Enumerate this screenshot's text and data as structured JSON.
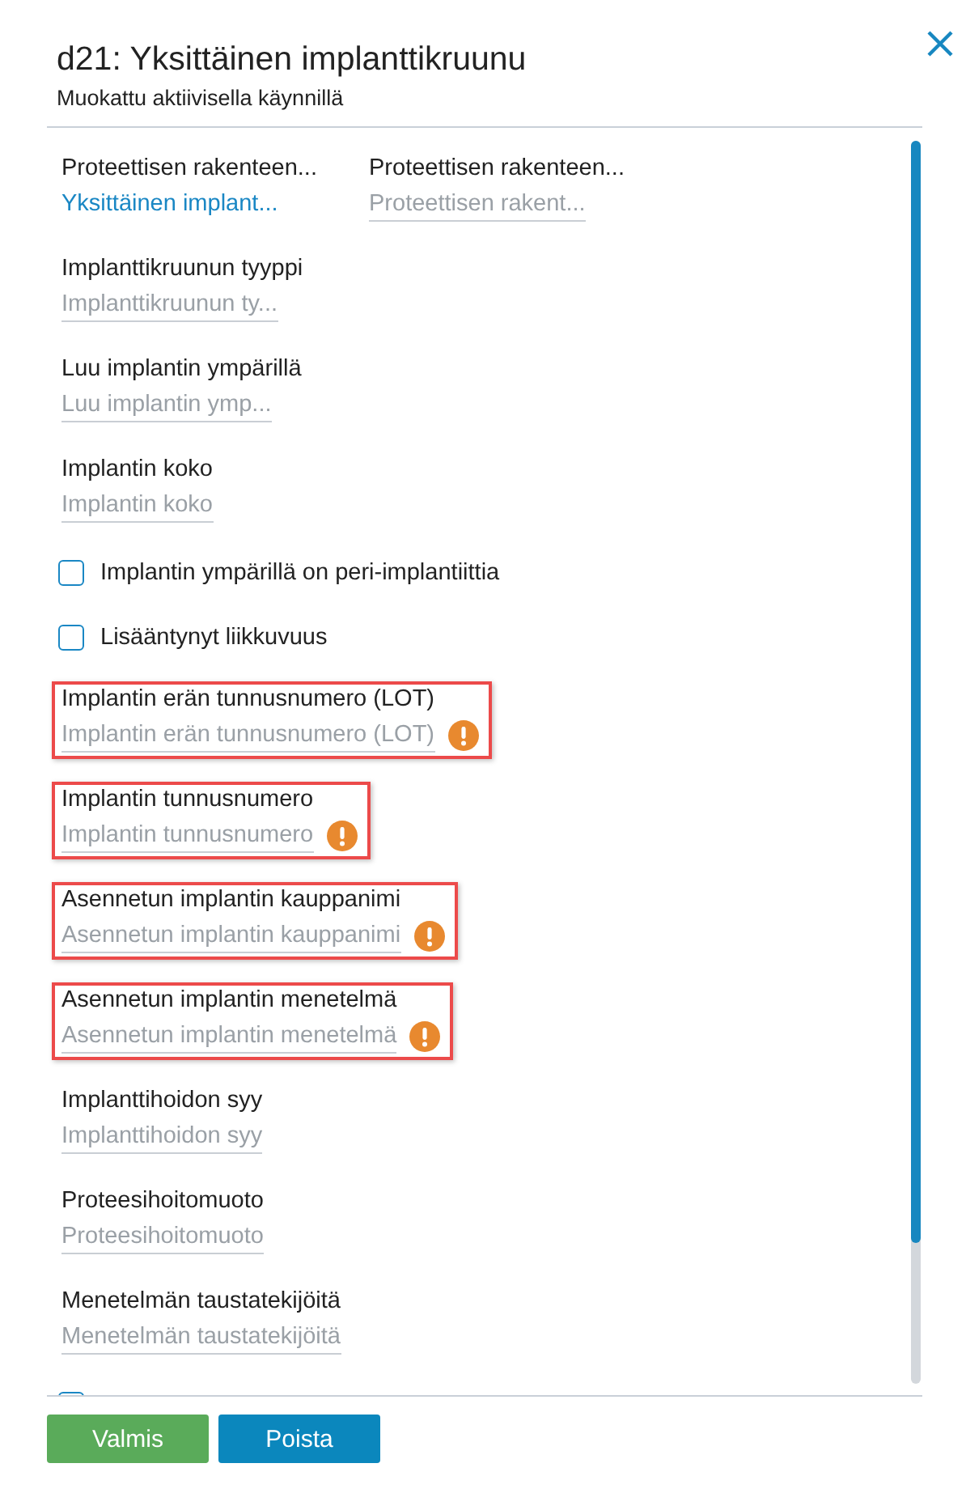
{
  "dialog": {
    "title": "d21: Yksittäinen implanttikruunu",
    "subtitle": "Muokattu aktiivisella käynnillä"
  },
  "items": [
    {
      "kind": "pair",
      "fields": [
        {
          "label": "Proteettisen rakenteen...",
          "value": "Yksittäinen implant..."
        },
        {
          "label": "Proteettisen rakenteen...",
          "placeholder": "Proteettisen rakent..."
        }
      ]
    },
    {
      "kind": "field",
      "label": "Implanttikruunun tyyppi",
      "placeholder": "Implanttikruunun ty...",
      "highlighted": false,
      "warning": false
    },
    {
      "kind": "field",
      "label": "Luu implantin ympärillä",
      "placeholder": "Luu implantin ymp...",
      "highlighted": false,
      "warning": false
    },
    {
      "kind": "field",
      "label": "Implantin koko",
      "placeholder": "Implantin koko",
      "highlighted": false,
      "warning": false
    },
    {
      "kind": "checkbox",
      "label": "Implantin ympärillä on peri-implantiittia",
      "checked": false
    },
    {
      "kind": "checkbox",
      "label": "Lisääntynyt liikkuvuus",
      "checked": false
    },
    {
      "kind": "field",
      "label": "Implantin erän tunnusnumero (LOT)",
      "placeholder": "Implantin erän tunnusnumero (LOT)",
      "highlighted": true,
      "warning": true
    },
    {
      "kind": "field",
      "label": "Implantin tunnusnumero",
      "placeholder": "Implantin tunnusnumero",
      "highlighted": true,
      "warning": true
    },
    {
      "kind": "field",
      "label": "Asennetun implantin kauppanimi",
      "placeholder": "Asennetun implantin kauppanimi",
      "highlighted": true,
      "warning": true
    },
    {
      "kind": "field",
      "label": "Asennetun implantin menetelmä",
      "placeholder": "Asennetun implantin menetelmä",
      "highlighted": true,
      "warning": true
    },
    {
      "kind": "field",
      "label": "Implanttihoidon syy",
      "placeholder": "Implanttihoidon syy",
      "highlighted": false,
      "warning": false
    },
    {
      "kind": "field",
      "label": "Proteesihoitomuoto",
      "placeholder": "Proteesihoitomuoto",
      "highlighted": false,
      "warning": false
    },
    {
      "kind": "field",
      "label": "Menetelmän taustatekijöitä",
      "placeholder": "Menetelmän taustatekijöitä",
      "highlighted": false,
      "warning": false
    },
    {
      "kind": "checkbox",
      "checked": false
    }
  ],
  "buttons": [
    {
      "label": "Valmis",
      "kind": "confirm"
    },
    {
      "label": "Poista",
      "kind": "delete"
    }
  ]
}
